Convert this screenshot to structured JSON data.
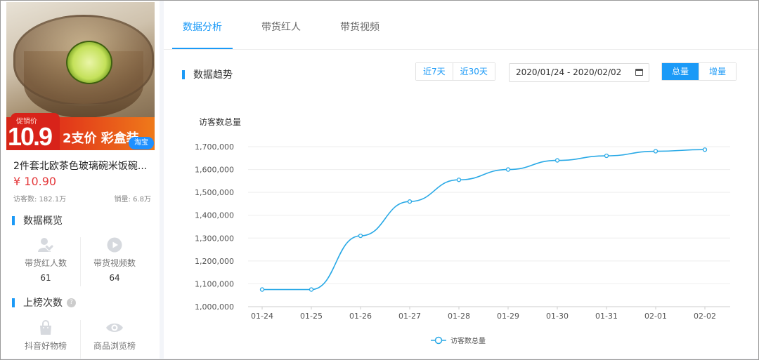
{
  "product": {
    "promo_label": "促销价",
    "promo_price": "10.9",
    "banner_text": "2支价 彩盒装",
    "platform_badge": "淘宝",
    "title": "2件套北欧茶色玻璃碗米饭碗...",
    "price": "¥ 10.90",
    "visitors": "访客数: 182.1万",
    "sales": "销量: 6.8万"
  },
  "overview": {
    "heading": "数据概览",
    "stats": [
      {
        "label": "带货红人数",
        "value": "61",
        "icon": "influencer-icon"
      },
      {
        "label": "带货视频数",
        "value": "64",
        "icon": "play-video-icon"
      }
    ]
  },
  "ranking": {
    "heading": "上榜次数",
    "help": "?",
    "stats": [
      {
        "label": "抖音好物榜",
        "icon": "shopping-bag-icon"
      },
      {
        "label": "商品浏览榜",
        "icon": "eye-icon"
      }
    ]
  },
  "tabs": [
    {
      "label": "数据分析",
      "active": true
    },
    {
      "label": "带货红人",
      "active": false
    },
    {
      "label": "带货视频",
      "active": false
    }
  ],
  "trend": {
    "heading": "数据趋势",
    "range_buttons": [
      "近7天",
      "近30天"
    ],
    "date_range": "2020/01/24 - 2020/02/02",
    "mode_buttons": [
      {
        "label": "总量",
        "active": true
      },
      {
        "label": "增量",
        "active": false
      }
    ]
  },
  "colors": {
    "accent": "#1b9af7",
    "price": "#e4393c",
    "line": "#29a9e6"
  },
  "chart_data": {
    "type": "line",
    "title": "访客数总量",
    "x": [
      "01-24",
      "01-25",
      "01-26",
      "01-27",
      "01-28",
      "01-29",
      "01-30",
      "01-31",
      "02-01",
      "02-02"
    ],
    "series": [
      {
        "name": "访客数总量",
        "values": [
          1075000,
          1075000,
          1310000,
          1460000,
          1555000,
          1600000,
          1640000,
          1660000,
          1680000,
          1687000
        ]
      }
    ],
    "yticks": [
      "1,000,000",
      "1,100,000",
      "1,200,000",
      "1,300,000",
      "1,400,000",
      "1,500,000",
      "1,600,000",
      "1,700,000"
    ],
    "ylim": [
      1000000,
      1700000
    ],
    "grid": true,
    "legend": "bottom-center"
  }
}
